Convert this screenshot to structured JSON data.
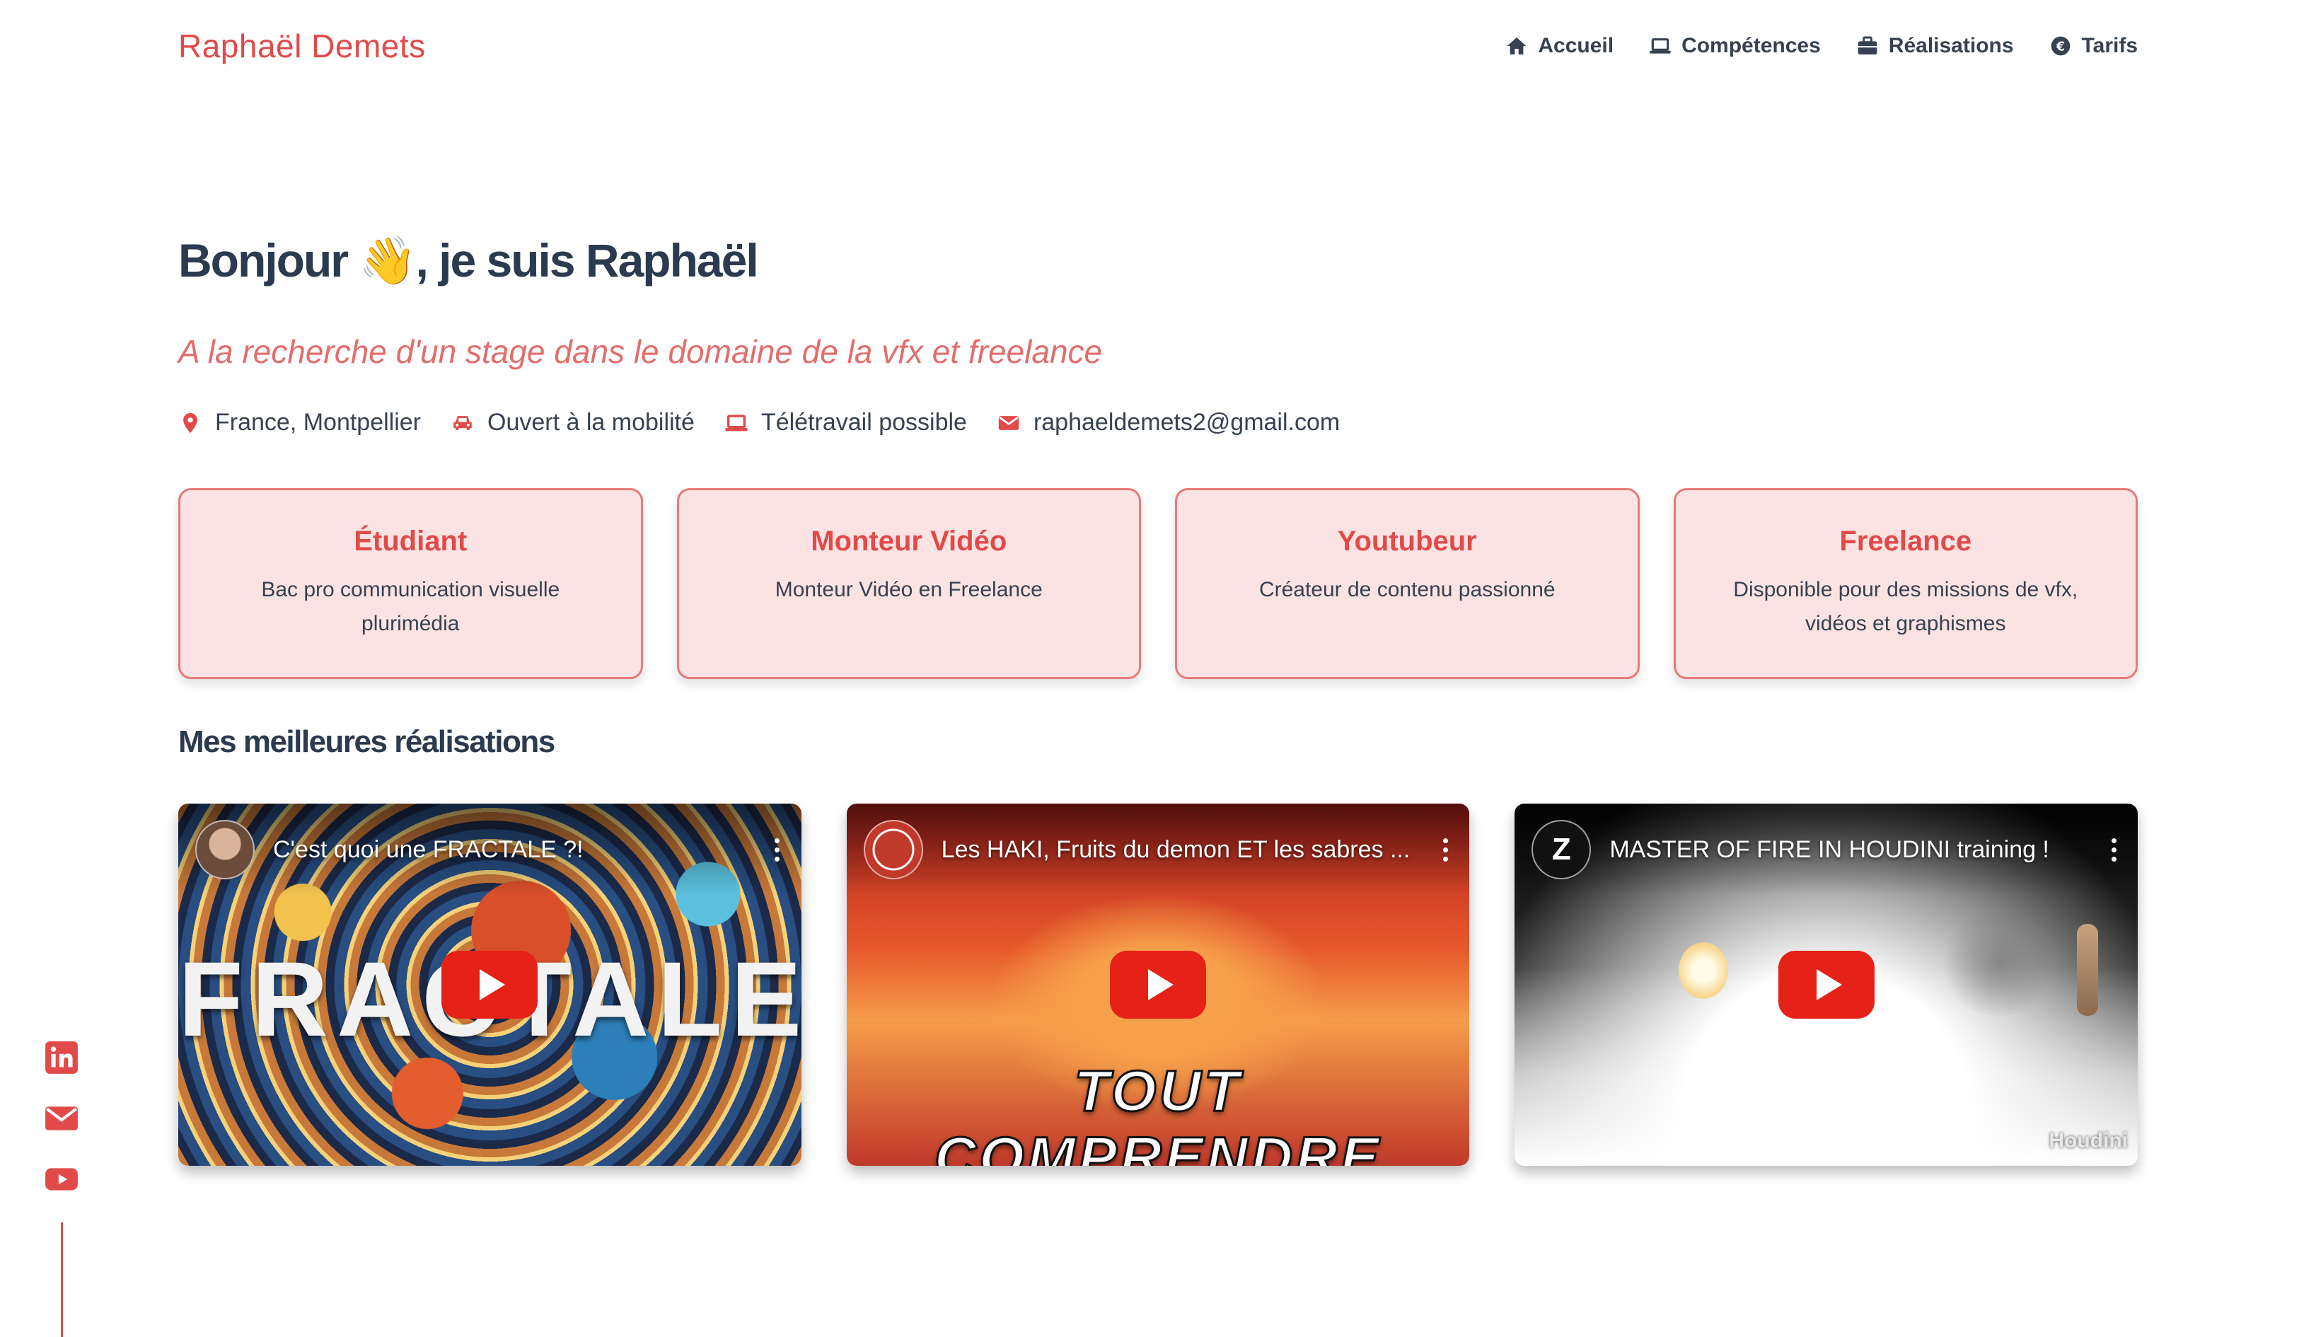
{
  "header": {
    "brand": "Raphaël Demets",
    "nav": [
      {
        "label": "Accueil",
        "icon": "home-icon"
      },
      {
        "label": "Compétences",
        "icon": "laptop-icon"
      },
      {
        "label": "Réalisations",
        "icon": "briefcase-icon"
      },
      {
        "label": "Tarifs",
        "icon": "euro-icon"
      }
    ]
  },
  "hero": {
    "title": "Bonjour 👋, je suis Raphaël",
    "subtitle": "A la recherche d'un stage dans le domaine de la vfx et freelance",
    "info": [
      {
        "label": "France, Montpellier",
        "icon": "location-pin-icon"
      },
      {
        "label": "Ouvert à la mobilité",
        "icon": "car-icon"
      },
      {
        "label": "Télétravail possible",
        "icon": "laptop-icon"
      },
      {
        "label": "raphaeldemets2@gmail.com",
        "icon": "mail-icon"
      }
    ]
  },
  "cards": [
    {
      "title": "Étudiant",
      "desc": "Bac pro communication visuelle plurimédia"
    },
    {
      "title": "Monteur Vidéo",
      "desc": "Monteur Vidéo en Freelance"
    },
    {
      "title": "Youtubeur",
      "desc": "Créateur de contenu passionné"
    },
    {
      "title": "Freelance",
      "desc": "Disponible pour des missions de vfx, vidéos et graphismes"
    }
  ],
  "section": {
    "title": "Mes meilleures réalisations"
  },
  "videos": [
    {
      "title": "C'est quoi une FRACTALE ?!",
      "thumb_text": "FRACTALE"
    },
    {
      "title": "Les HAKI, Fruits du demon ET les sabres ...",
      "thumb_text": "TOUT COMPRENDRE"
    },
    {
      "title": "MASTER OF FIRE IN HOUDINI training !",
      "thumb_text": "Houdini",
      "channel_letter": "Z"
    }
  ],
  "social": [
    {
      "name": "linkedin-icon"
    },
    {
      "name": "mail-icon"
    },
    {
      "name": "youtube-icon"
    }
  ],
  "colors": {
    "accent": "#e14a49",
    "card_bg": "#fbe3e3",
    "card_border": "#e87a79",
    "heading": "#2c3a4f",
    "youtube_red": "#e62117"
  }
}
